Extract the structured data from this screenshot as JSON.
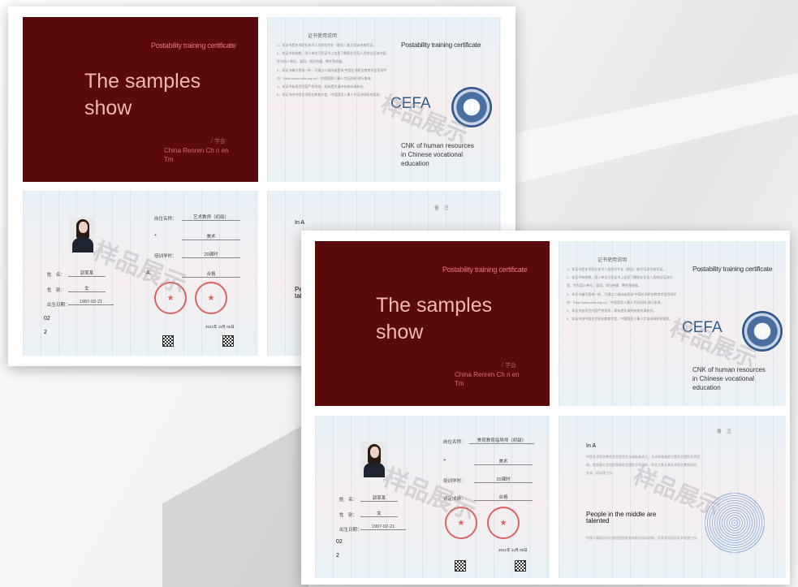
{
  "certificate": {
    "cover": {
      "header": "Postability training certificate",
      "title_line1": "The samples",
      "title_line2": "show",
      "signature_text": "/ 学会",
      "issuer_line1": "China Renren Ch n en",
      "issuer_line2": "Tm"
    },
    "rules": {
      "heading": "证书使用说明",
      "items": [
        "1、本证书是艺术职业技术人员岗位专业（职业）能力培训合格凭证。",
        "2、本证书有效期，用人单位可凭证书上信息了解职业学员人员岗位培训内容，作为用人单位，录用、岗位待遇、聘任等依据。",
        "3、本证书编号是唯一的，可通过二维码或登录“中国艺术职业教育学会官网平台”（http://www.cefa.org.cn）“中国国家人事人才培训网”进行查询。",
        "4、本证书各项目内容严禁涂改，如有遗失请持有效申请补办。",
        "5、本证书由中国艺术职业教育学会、中国国家人事人才培训网联合颁发。"
      ]
    },
    "brand": {
      "header": "Postability training certificate",
      "cefa": "CEFA",
      "logo_text": "ie",
      "desc_line1": "CNK of human resources",
      "desc_line2": "in Chinese vocational",
      "desc_line3": "education"
    },
    "info": {
      "position_label": "岗位名称：",
      "position_value_a": "艺术教师（初级）",
      "position_value_b": "美育教育指导师（初级）",
      "level_mark": "+",
      "major_value": "美术",
      "hours_label": "培训学时：",
      "hours_value": "20课时",
      "eval_label": "评定成绩：",
      "eval_value": "合格",
      "name_label": "姓　名：",
      "name_value": "郭某某",
      "gender_label": "性　别：",
      "gender_value": "女",
      "birth_label": "出生日期：",
      "birth_value": "1997-02-21",
      "mark_a": "A",
      "number_line1": "02",
      "number_line2": "2",
      "issue_date": "2021年 11月 08日"
    },
    "remarks": {
      "note_label": "备　注",
      "heading": "In A",
      "talent_line1": "People in the middle are",
      "talent_line2": "talented",
      "body": "中国艺术职业教育学会是经文化部批准成立，文化和旅游部主管的全国性学术团体。是具备社会组织等级的全国性学术团体，学会主要从事艺术职业教育研究、交流、培训等工作。",
      "footer": "中国人事报告中心是经国家批准的职业培训机构，负责学员培训证书发放工作。"
    },
    "watermark": "样品展示"
  }
}
